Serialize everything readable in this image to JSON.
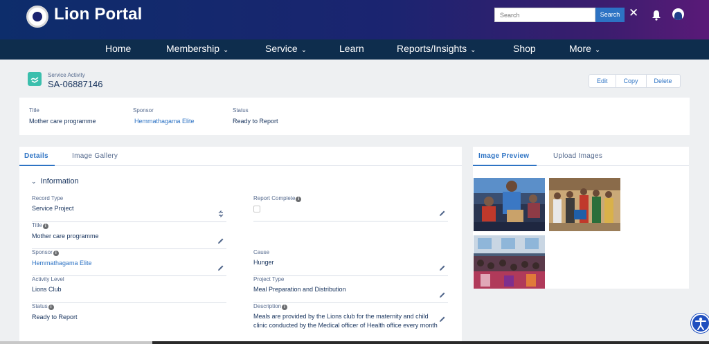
{
  "header": {
    "brand": "Lion Portal",
    "search_placeholder": "Search",
    "search_button": "Search",
    "close_symbol": "✕",
    "icons": [
      "logo-icon",
      "close-icon",
      "bell-icon",
      "avatar-icon"
    ]
  },
  "nav": {
    "items": [
      {
        "label": "Home",
        "has_menu": false
      },
      {
        "label": "Membership",
        "has_menu": true
      },
      {
        "label": "Service",
        "has_menu": true
      },
      {
        "label": "Learn",
        "has_menu": false
      },
      {
        "label": "Reports/Insights",
        "has_menu": true
      },
      {
        "label": "Shop",
        "has_menu": false
      },
      {
        "label": "More",
        "has_menu": true
      }
    ]
  },
  "record": {
    "type": "Service Activity",
    "id": "SA-06887146",
    "actions": [
      "Edit",
      "Copy",
      "Delete"
    ]
  },
  "summary": {
    "title_label": "Title",
    "title_value": "Mother care programme",
    "sponsor_label": "Sponsor",
    "sponsor_value": "Hemmathagama Elite",
    "status_label": "Status",
    "status_value": "Ready to Report"
  },
  "details": {
    "tabs": [
      "Details",
      "Image Gallery"
    ],
    "section_title": "Information",
    "fields": {
      "record_type_label": "Record Type",
      "record_type_value": "Service Project",
      "report_complete_label": "Report Complete",
      "title_label": "Title",
      "title_value": "Mother care programme",
      "sponsor_label": "Sponsor",
      "sponsor_value": "Hemmathagama Elite",
      "cause_label": "Cause",
      "cause_value": "Hunger",
      "activity_level_label": "Activity Level",
      "activity_level_value": "Lions Club",
      "project_type_label": "Project Type",
      "project_type_value": "Meal Preparation and Distribution",
      "status_label": "Status",
      "status_value": "Ready to Report",
      "description_label": "Description",
      "description_value": "Meals are provided by the Lions club for the maternity and child clinic conducted by the Medical officer of Health office every month"
    },
    "info_glyph": "i"
  },
  "images": {
    "tabs": [
      "Image Preview",
      "Upload Images"
    ]
  },
  "colors": {
    "accent": "#2d73c4",
    "nav_bg": "#0e2d4d",
    "teal_icon": "#3bbfad"
  }
}
